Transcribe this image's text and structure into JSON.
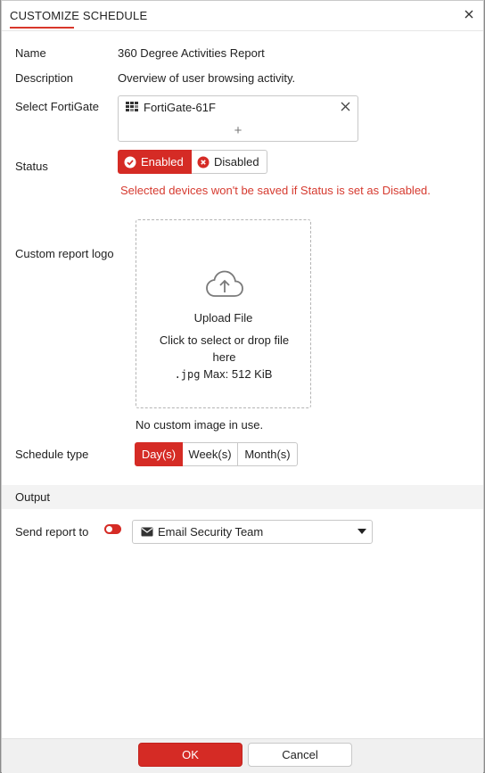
{
  "dialog": {
    "title": "CUSTOMIZE SCHEDULE"
  },
  "fields": {
    "name_label": "Name",
    "name_value": "360 Degree Activities Report",
    "description_label": "Description",
    "description_value": "Overview of user browsing activity.",
    "fortigate_label": "Select FortiGate",
    "fortigate_device": "FortiGate-61F",
    "fortigate_add": "+",
    "status_label": "Status",
    "status_enabled": "Enabled",
    "status_disabled": "Disabled",
    "status_selected": "Enabled",
    "status_warning": "Selected devices won't be saved if Status is set as Disabled.",
    "logo_label": "Custom report logo",
    "upload_title": "Upload File",
    "upload_hint": "Click to select or drop file here",
    "upload_ext": ".jpg",
    "upload_max": "Max: 512 KiB",
    "no_image": "No custom image in use.",
    "schedule_label": "Schedule type",
    "schedule_options": [
      "Day(s)",
      "Week(s)",
      "Month(s)"
    ],
    "schedule_selected": "Day(s)"
  },
  "output": {
    "section_title": "Output",
    "send_label": "Send report to",
    "send_enabled": true,
    "recipient": "Email Security Team"
  },
  "footer": {
    "ok_label": "OK",
    "cancel_label": "Cancel"
  },
  "colors": {
    "accent": "#d52b25",
    "warning_text": "#d63a2f"
  },
  "icons": {
    "close": "close-icon",
    "device": "fortigate-device-icon",
    "remove": "remove-icon",
    "enabled": "check-circle-icon",
    "disabled": "x-circle-icon",
    "upload": "cloud-upload-icon",
    "email": "envelope-icon",
    "caret": "caret-down-icon"
  }
}
